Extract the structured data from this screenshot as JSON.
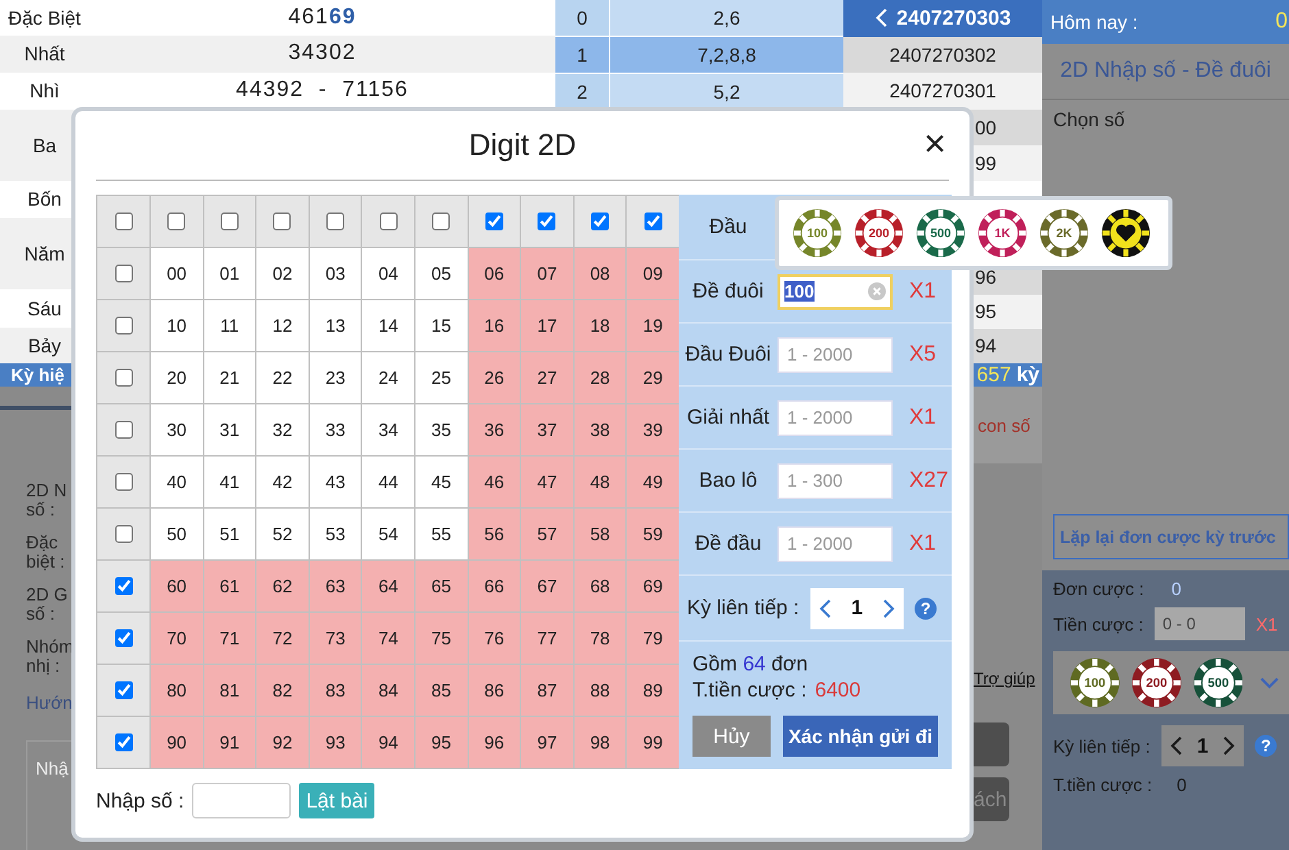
{
  "results": [
    {
      "label": "Đặc Biệt",
      "value": "461**69**"
    },
    {
      "label": "Nhất",
      "value": "34302"
    },
    {
      "label": "Nhì",
      "value": "44392  -  71156"
    },
    {
      "label": "Ba"
    },
    {
      "label": "Bốn"
    },
    {
      "label": "Năm"
    },
    {
      "label": "Sáu"
    },
    {
      "label": "Bảy"
    }
  ],
  "digit_stats": [
    {
      "digit": "0",
      "values": "2,6",
      "selected": false
    },
    {
      "digit": "1",
      "values": "7,2,8,8",
      "selected": true
    },
    {
      "digit": "2",
      "values": "5,2",
      "selected": false
    }
  ],
  "periods": [
    {
      "code": "2407270303",
      "selected": true
    },
    {
      "code": "2407270302",
      "selected": false
    },
    {
      "code": "2407270301",
      "selected": false
    }
  ],
  "period_fragments": [
    "00",
    "99",
    "96",
    "95",
    "94"
  ],
  "period_bar": {
    "label": "Kỳ hiệ",
    "count": "657",
    "unit": "kỳ"
  },
  "form_labels": [
    [
      "2D N",
      "số :"
    ],
    [
      "Đặc",
      "biệt :"
    ],
    [
      "2D G",
      "số :"
    ],
    [
      "Nhóm",
      "nhị :"
    ]
  ],
  "guide_link": "Hướn",
  "notes_placeholder": "Nhậ",
  "hint_fragment": "con số",
  "help_link": "Trợ giúp",
  "button_fragment": "ách",
  "side": {
    "today_label": "Hôm nay :",
    "today_value": "0",
    "title": "2D Nhập số - Đề đuôi",
    "pick_label": "Chọn số",
    "repeat_button": "Lặp lại đơn cược kỳ trước",
    "orders_label": "Đơn cược :",
    "orders_value": "0",
    "stake_label": "Tiền cược :",
    "stake_placeholder": "0 - 0",
    "stake_multiplier": "X1",
    "chips": [
      {
        "kind": "value",
        "label": "100",
        "color": "#5f6a22"
      },
      {
        "kind": "value",
        "label": "200",
        "color": "#8e1c22"
      },
      {
        "kind": "value",
        "label": "500",
        "color": "#17513a"
      }
    ],
    "periods_label": "Kỳ liên tiếp :",
    "periods_value": "1",
    "help": "?",
    "total_label": "T.tiền cược :",
    "total_value": "0"
  },
  "modal": {
    "title": "Digit 2D",
    "close": "×",
    "all_checked": false,
    "columns": [
      {
        "checked": false
      },
      {
        "checked": false
      },
      {
        "checked": false
      },
      {
        "checked": false
      },
      {
        "checked": false
      },
      {
        "checked": false
      },
      {
        "checked": true
      },
      {
        "checked": true
      },
      {
        "checked": true
      },
      {
        "checked": true
      }
    ],
    "rows": [
      {
        "checked": false,
        "cells": [
          "00",
          "01",
          "02",
          "03",
          "04",
          "05",
          "06",
          "07",
          "08",
          "09"
        ]
      },
      {
        "checked": false,
        "cells": [
          "10",
          "11",
          "12",
          "13",
          "14",
          "15",
          "16",
          "17",
          "18",
          "19"
        ]
      },
      {
        "checked": false,
        "cells": [
          "20",
          "21",
          "22",
          "23",
          "24",
          "25",
          "26",
          "27",
          "28",
          "29"
        ]
      },
      {
        "checked": false,
        "cells": [
          "30",
          "31",
          "32",
          "33",
          "34",
          "35",
          "36",
          "37",
          "38",
          "39"
        ]
      },
      {
        "checked": false,
        "cells": [
          "40",
          "41",
          "42",
          "43",
          "44",
          "45",
          "46",
          "47",
          "48",
          "49"
        ]
      },
      {
        "checked": false,
        "cells": [
          "50",
          "51",
          "52",
          "53",
          "54",
          "55",
          "56",
          "57",
          "58",
          "59"
        ]
      },
      {
        "checked": true,
        "cells": [
          "60",
          "61",
          "62",
          "63",
          "64",
          "65",
          "66",
          "67",
          "68",
          "69"
        ]
      },
      {
        "checked": true,
        "cells": [
          "70",
          "71",
          "72",
          "73",
          "74",
          "75",
          "76",
          "77",
          "78",
          "79"
        ]
      },
      {
        "checked": true,
        "cells": [
          "80",
          "81",
          "82",
          "83",
          "84",
          "85",
          "86",
          "87",
          "88",
          "89"
        ]
      },
      {
        "checked": true,
        "cells": [
          "90",
          "91",
          "92",
          "93",
          "94",
          "95",
          "96",
          "97",
          "98",
          "99"
        ]
      }
    ],
    "bets": [
      {
        "label": "Đầu"
      },
      {
        "label": "Đề đuôi",
        "value": "100",
        "focused": true,
        "multiplier": "X1"
      },
      {
        "label": "Đầu Đuôi",
        "placeholder": "1 - 2000",
        "focused": false,
        "multiplier": "X5"
      },
      {
        "label": "Giải nhất",
        "placeholder": "1 - 2000",
        "focused": false,
        "multiplier": "X1"
      },
      {
        "label": "Bao lô",
        "placeholder": "1 - 300",
        "focused": false,
        "multiplier": "X27"
      },
      {
        "label": "Đề đầu",
        "placeholder": "1 - 2000",
        "focused": false,
        "multiplier": "X1"
      }
    ],
    "periods_label": "Kỳ liên tiếp :",
    "periods_value": "1",
    "help": "?",
    "summary": "Gồm **64** đơn",
    "total_label": "T.tiền cược :",
    "total_value": "6400",
    "cancel": "Hủy",
    "confirm": "Xác nhận gửi đi",
    "entry_label": "Nhập số :",
    "flip_button": "Lật bài"
  },
  "chip_picker": [
    {
      "kind": "value",
      "label": "100",
      "color": "#76862a"
    },
    {
      "kind": "value",
      "label": "200",
      "color": "#b8202a"
    },
    {
      "kind": "value",
      "label": "500",
      "color": "#1a6a4a"
    },
    {
      "kind": "value",
      "label": "1K",
      "color": "#c0205a"
    },
    {
      "kind": "value",
      "label": "2K",
      "color": "#6a6a2a"
    },
    {
      "kind": "heart",
      "color": "#f2e21c"
    }
  ]
}
